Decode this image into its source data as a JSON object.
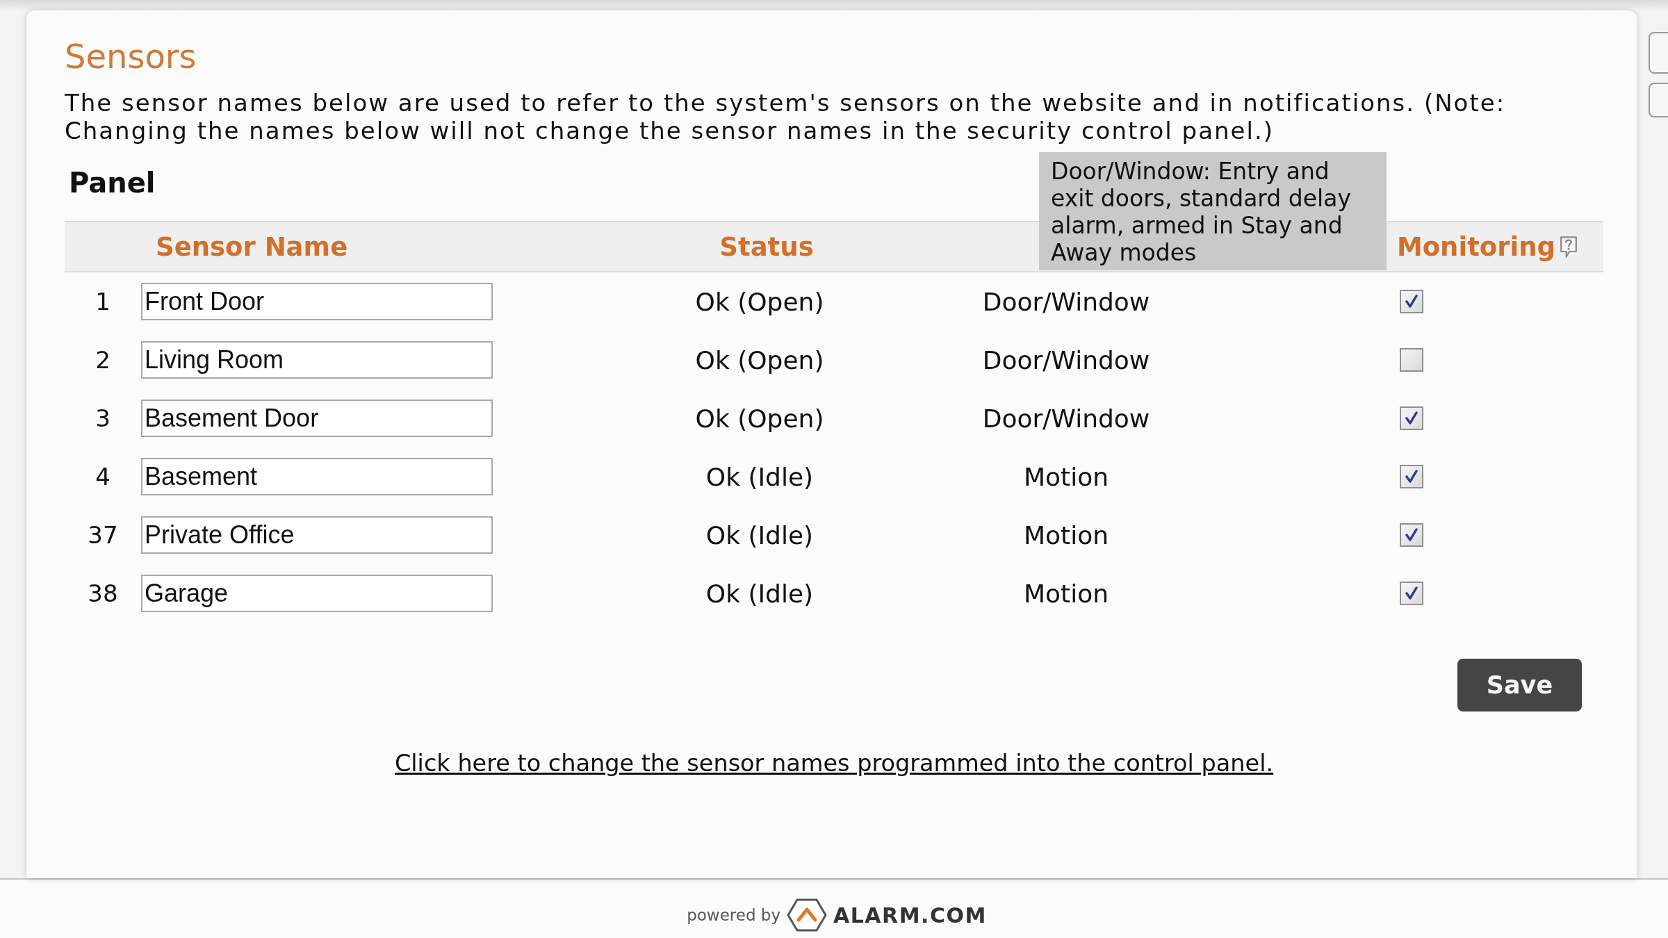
{
  "page": {
    "title": "Sensors",
    "description": "The sensor names below are used to refer to the system's sensors on the website and in notifications. (Note: Changing the names below will not change the sensor names in the security control panel.)"
  },
  "panel": {
    "heading": "Panel",
    "columns": {
      "sensor_name": "Sensor Name",
      "status": "Status",
      "monitoring": "Monitoring"
    },
    "rows": [
      {
        "number": "1",
        "name": "Front Door",
        "status": "Ok (Open)",
        "type": "Door/Window",
        "monitoring": true
      },
      {
        "number": "2",
        "name": "Living Room",
        "status": "Ok (Open)",
        "type": "Door/Window",
        "monitoring": false
      },
      {
        "number": "3",
        "name": "Basement Door",
        "status": "Ok (Open)",
        "type": "Door/Window",
        "monitoring": true
      },
      {
        "number": "4",
        "name": "Basement",
        "status": "Ok (Idle)",
        "type": "Motion",
        "monitoring": true
      },
      {
        "number": "37",
        "name": "Private Office",
        "status": "Ok (Idle)",
        "type": "Motion",
        "monitoring": true
      },
      {
        "number": "38",
        "name": "Garage",
        "status": "Ok (Idle)",
        "type": "Motion",
        "monitoring": true
      }
    ]
  },
  "tooltip": {
    "text": "Door/Window: Entry and exit doors, standard delay alarm, armed in Stay and Away modes"
  },
  "save_button": "Save",
  "link": "Click here to change the sensor names programmed into the control panel.",
  "footer": {
    "powered_by": "powered by",
    "brand": "ALARM.COM"
  }
}
